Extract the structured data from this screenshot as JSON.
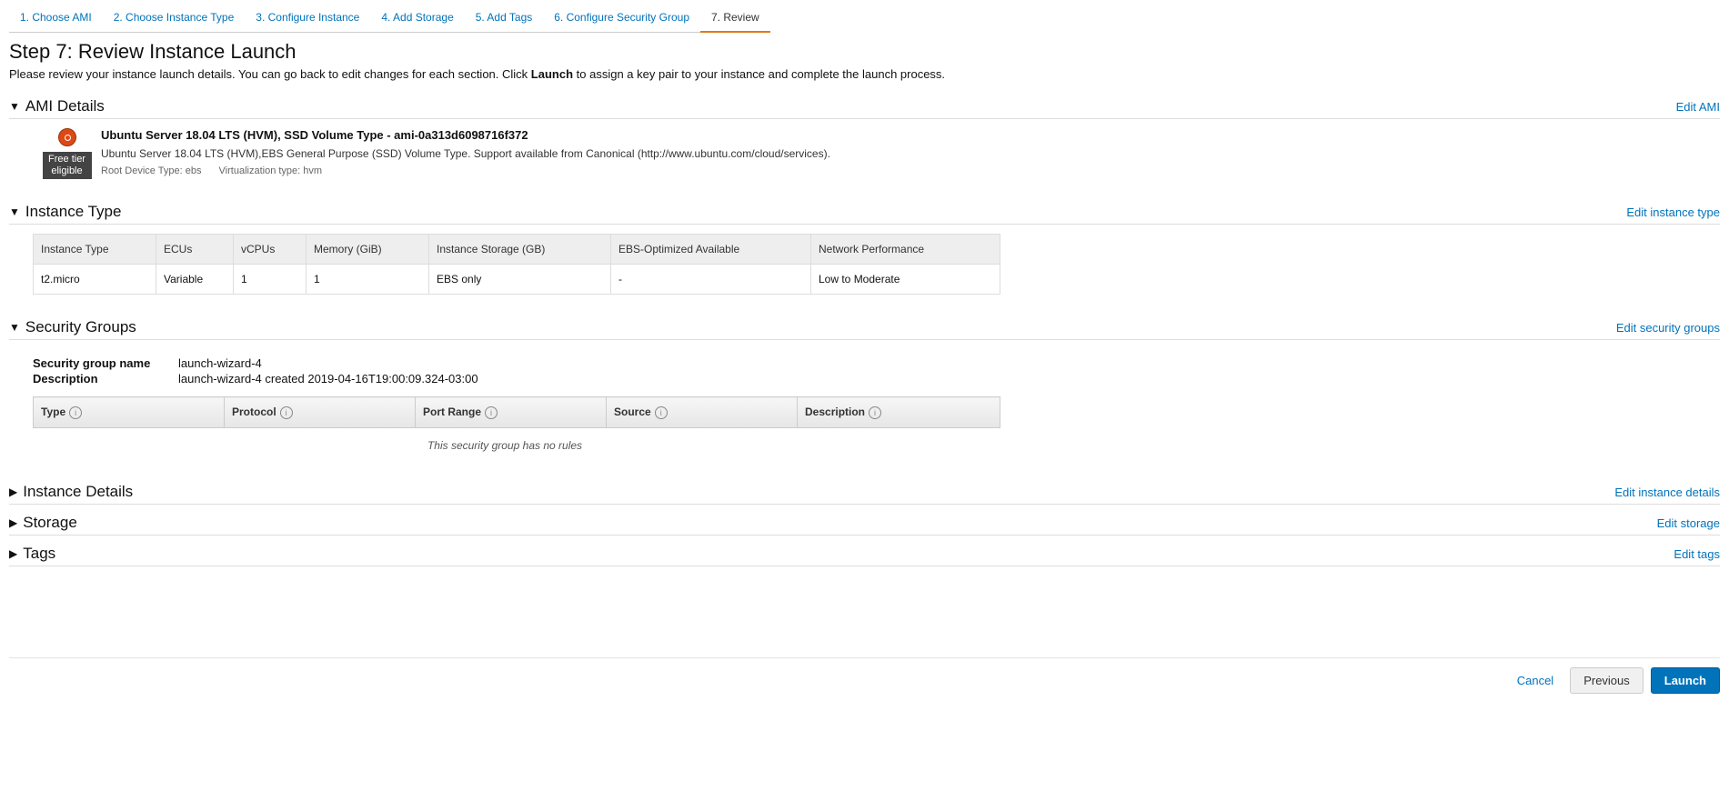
{
  "wizard": {
    "steps": [
      {
        "label": "1. Choose AMI"
      },
      {
        "label": "2. Choose Instance Type"
      },
      {
        "label": "3. Configure Instance"
      },
      {
        "label": "4. Add Storage"
      },
      {
        "label": "5. Add Tags"
      },
      {
        "label": "6. Configure Security Group"
      },
      {
        "label": "7. Review"
      }
    ]
  },
  "page": {
    "title": "Step 7: Review Instance Launch",
    "desc_pre": "Please review your instance launch details. You can go back to edit changes for each section. Click ",
    "desc_bold": "Launch",
    "desc_post": " to assign a key pair to your instance and complete the launch process."
  },
  "ami_section": {
    "title": "AMI Details",
    "edit": "Edit AMI",
    "free_tier_line1": "Free tier",
    "free_tier_line2": "eligible",
    "name": "Ubuntu Server 18.04 LTS (HVM), SSD Volume Type - ami-0a313d6098716f372",
    "description": "Ubuntu Server 18.04 LTS (HVM),EBS General Purpose (SSD) Volume Type. Support available from Canonical (http://www.ubuntu.com/cloud/services).",
    "root_device": "Root Device Type: ebs",
    "virt_type": "Virtualization type: hvm"
  },
  "instance_section": {
    "title": "Instance Type",
    "edit": "Edit instance type",
    "headers": {
      "type": "Instance Type",
      "ecus": "ECUs",
      "vcpus": "vCPUs",
      "memory": "Memory (GiB)",
      "storage": "Instance Storage (GB)",
      "ebs": "EBS-Optimized Available",
      "network": "Network Performance"
    },
    "row": {
      "type": "t2.micro",
      "ecus": "Variable",
      "vcpus": "1",
      "memory": "1",
      "storage": "EBS only",
      "ebs": "-",
      "network": "Low to Moderate"
    }
  },
  "sg_section": {
    "title": "Security Groups",
    "edit": "Edit security groups",
    "name_label": "Security group name",
    "name_value": "launch-wizard-4",
    "desc_label": "Description",
    "desc_value": "launch-wizard-4 created 2019-04-16T19:00:09.324-03:00",
    "rules_headers": {
      "type": "Type",
      "protocol": "Protocol",
      "port": "Port Range",
      "source": "Source",
      "desc": "Description"
    },
    "no_rules": "This security group has no rules"
  },
  "details_section": {
    "title": "Instance Details",
    "edit": "Edit instance details"
  },
  "storage_section": {
    "title": "Storage",
    "edit": "Edit storage"
  },
  "tags_section": {
    "title": "Tags",
    "edit": "Edit tags"
  },
  "footer": {
    "cancel": "Cancel",
    "previous": "Previous",
    "launch": "Launch"
  }
}
